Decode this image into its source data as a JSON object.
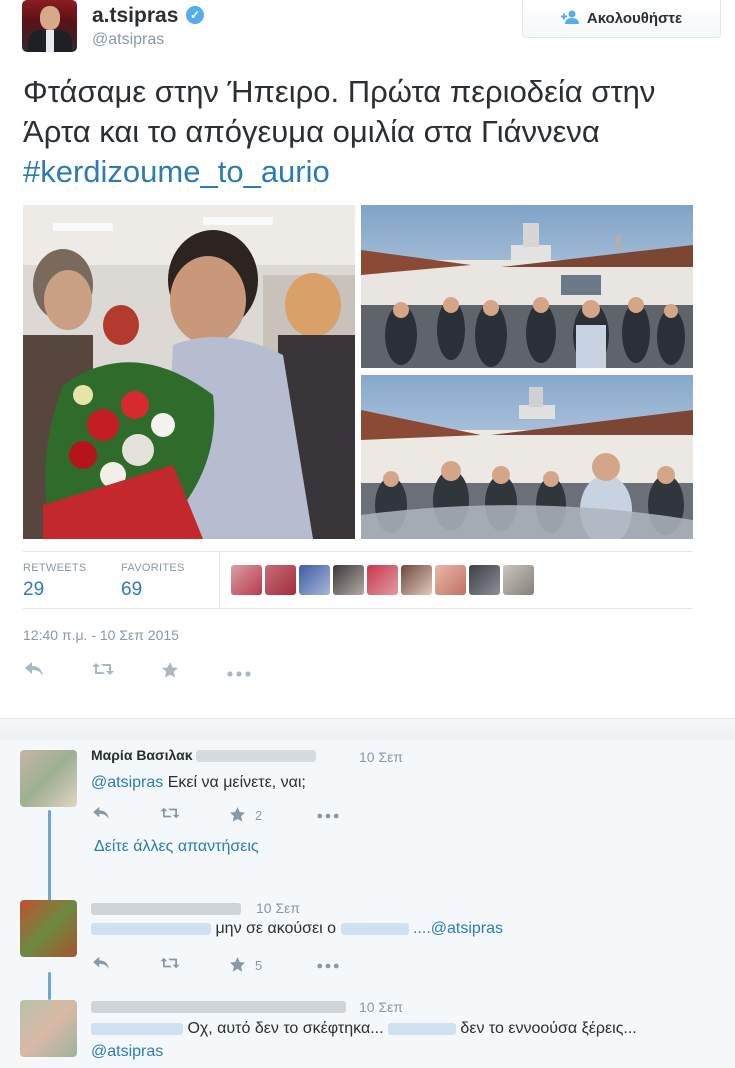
{
  "tweet": {
    "fullname": "a.tsipras",
    "handle": "@atsipras",
    "follow_label": "Ακολουθήστε",
    "text_main": "Φτάσαμε στην Ήπειρο. Πρώτα περιοδεία στην Άρτα και το απόγευμα ομιλία στα Γιάννενα ",
    "hashtag": "#kerdizoume_to_aurio",
    "stats": {
      "retweets_label": "RETWEETS",
      "retweets": "29",
      "favorites_label": "FAVORITES",
      "favorites": "69"
    },
    "timestamp": "12:40 π.μ. - 10 Σεπ 2015",
    "actions": [
      "reply-icon",
      "retweet-icon",
      "favorite-icon",
      "more-icon"
    ]
  },
  "replies": [
    {
      "name_visible": "Μαρία Βασιλακ",
      "time": "10 Σεπ",
      "mention": "@atsipras",
      "text": " Εκεί να μείνετε, ναι;",
      "favorites": "2"
    },
    {
      "more_link": "Δείτε άλλες απαντήσεις"
    },
    {
      "time": "10 Σεπ",
      "text": "μην σε ακούσει ο",
      "mention": "....@atsipras",
      "favorites": "5"
    },
    {
      "time": "10 Σεπ",
      "text": " Οχ, αυτό δεν το σκέφτηκα... ",
      "text2": " δεν το εννοούσα ξέρεις...",
      "mention": "@atsipras"
    }
  ],
  "colors": {
    "link": "#2b7bb9",
    "muted": "#8899a6",
    "verified": "#55acee"
  }
}
